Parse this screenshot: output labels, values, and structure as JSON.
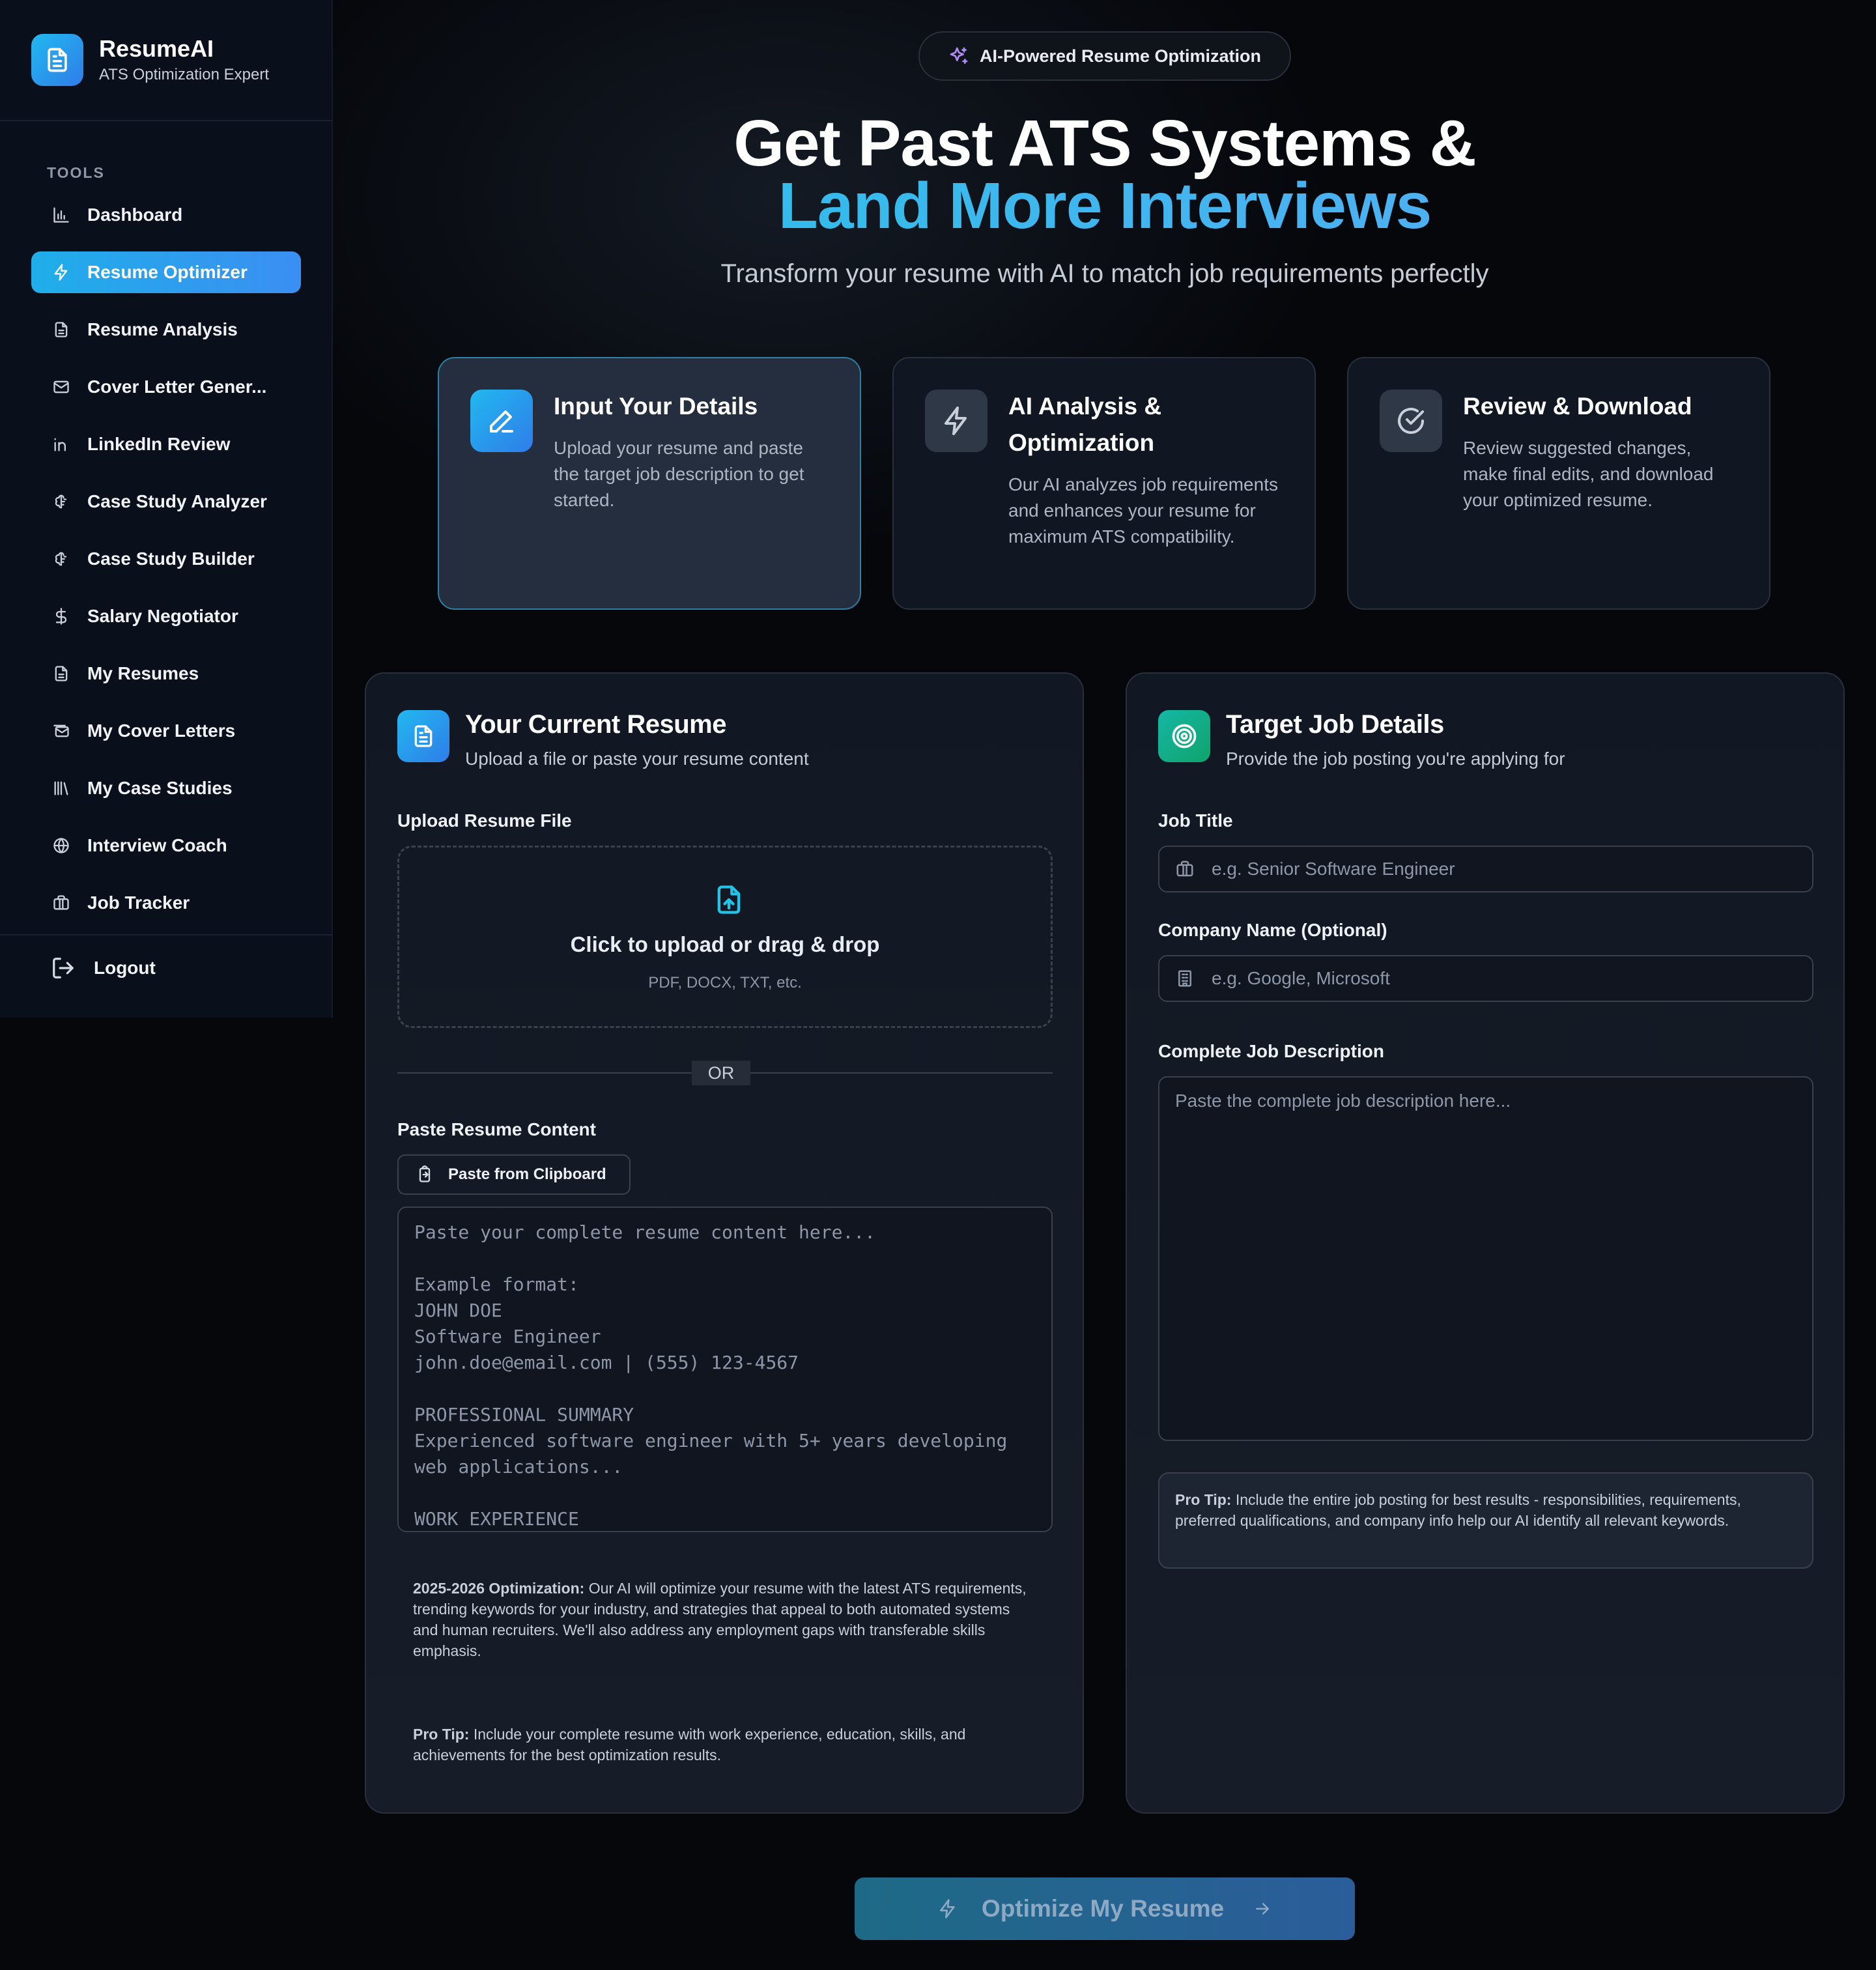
{
  "brand": {
    "title": "ResumeAI",
    "subtitle": "ATS Optimization Expert"
  },
  "sidebar": {
    "section_label": "TOOLS",
    "items": [
      {
        "label": "Dashboard",
        "icon": "bar-chart-icon"
      },
      {
        "label": "Resume Optimizer",
        "icon": "bolt-icon",
        "active": true
      },
      {
        "label": "Resume Analysis",
        "icon": "document-icon"
      },
      {
        "label": "Cover Letter Gener...",
        "icon": "mail-icon"
      },
      {
        "label": "LinkedIn Review",
        "icon": "linkedin-icon"
      },
      {
        "label": "Case Study Analyzer",
        "icon": "brain-icon"
      },
      {
        "label": "Case Study Builder",
        "icon": "brain-icon"
      },
      {
        "label": "Salary Negotiator",
        "icon": "dollar-icon"
      },
      {
        "label": "My Resumes",
        "icon": "document-icon"
      },
      {
        "label": "My Cover Letters",
        "icon": "mail-stack-icon"
      },
      {
        "label": "My Case Studies",
        "icon": "library-icon"
      },
      {
        "label": "Interview Coach",
        "icon": "globe-icon"
      },
      {
        "label": "Job Tracker",
        "icon": "briefcase-icon"
      }
    ],
    "logout_label": "Logout"
  },
  "hero": {
    "badge": "AI-Powered Resume Optimization",
    "title_line1": "Get Past ATS Systems &",
    "title_line2": "Land More Interviews",
    "subtitle": "Transform your resume with AI to match job requirements perfectly"
  },
  "steps": [
    {
      "title": "Input Your Details",
      "desc": "Upload your resume and paste the target job description to get started.",
      "icon": "pencil-icon"
    },
    {
      "title": "AI Analysis & Optimization",
      "desc": "Our AI analyzes job requirements and enhances your resume for maximum ATS compatibility.",
      "icon": "bolt-icon"
    },
    {
      "title": "Review & Download",
      "desc": "Review suggested changes, make final edits, and download your optimized resume.",
      "icon": "check-circle-icon"
    }
  ],
  "resume_panel": {
    "title": "Your Current Resume",
    "subtitle": "Upload a file or paste your resume content",
    "upload_label": "Upload Resume File",
    "dropzone_title": "Click to upload or drag & drop",
    "dropzone_sub": "PDF, DOCX, TXT, etc.",
    "or_text": "OR",
    "paste_label": "Paste Resume Content",
    "clipboard_button": "Paste from Clipboard",
    "textarea_placeholder": "Paste your complete resume content here...\n\nExample format:\nJOHN DOE\nSoftware Engineer\njohn.doe@email.com | (555) 123-4567\n\nPROFESSIONAL SUMMARY\nExperienced software engineer with 5+ years developing web applications...\n\nWORK EXPERIENCE",
    "optimization_note_bold": "2025-2026 Optimization:",
    "optimization_note": " Our AI will optimize your resume with the latest ATS requirements, trending keywords for your industry, and strategies that appeal to both automated systems and human recruiters. We'll also address any employment gaps with transferable skills emphasis.",
    "pro_tip_bold": "Pro Tip:",
    "pro_tip": " Include your complete resume with work experience, education, skills, and achievements for the best optimization results."
  },
  "job_panel": {
    "title": "Target Job Details",
    "subtitle": "Provide the job posting you're applying for",
    "job_title_label": "Job Title",
    "job_title_placeholder": "e.g. Senior Software Engineer",
    "company_label": "Company Name (Optional)",
    "company_placeholder": "e.g. Google, Microsoft",
    "description_label": "Complete Job Description",
    "description_placeholder": "Paste the complete job description here...",
    "pro_tip_bold": "Pro Tip:",
    "pro_tip": " Include the entire job posting for best results - responsibilities, requirements, preferred qualifications, and company info help our AI identify all relevant keywords."
  },
  "cta": {
    "label": "Optimize My Resume"
  },
  "colors": {
    "accent": "#22b8f0",
    "accent2": "#3b8ff2",
    "teal": "#14b8a6"
  }
}
